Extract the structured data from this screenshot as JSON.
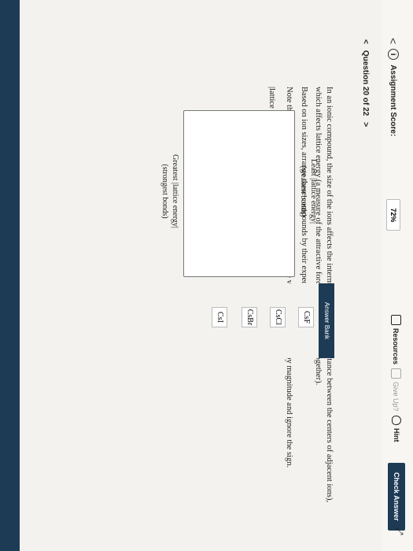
{
  "header": {
    "back_label": "<",
    "score_label": "Assignment Score:",
    "score_value": "72%",
    "resources_label": "Resources",
    "giveup_label": "Give Up?",
    "hint_label": "Hint",
    "check_label": "Check Answer"
  },
  "question_nav": {
    "prev": "<",
    "label": "Question 20 of 22",
    "next": ">"
  },
  "prompt": {
    "p1": "In an ionic compound, the size of the ions affects the internuclear distance (the distance between the centers of adjacent ions), which affects lattice energy (a measure of the attractive force holding those ions together).",
    "p2": "Based on ion sizes, arrange these compounds by their expected lattice energy.",
    "p3": "Note that many sources define lattice energies as negative values. Please arrange by magnitude and ignore the sign.",
    "formula": "|lattice energy| = absolute value of the lattice energy"
  },
  "ranking": {
    "greatest": "Greatest |lattice energy|",
    "greatest_sub": "(strongest bonds)",
    "least": "Least |lattice energy|",
    "least_sub": "(weakest bonds)"
  },
  "answer_bank": {
    "title": "Answer Bank",
    "items": [
      "CsI",
      "CsBr",
      "CsCl",
      "CsF"
    ]
  },
  "colors": {
    "accent": "#1e3b55",
    "page_bg": "#f4f2ee"
  }
}
